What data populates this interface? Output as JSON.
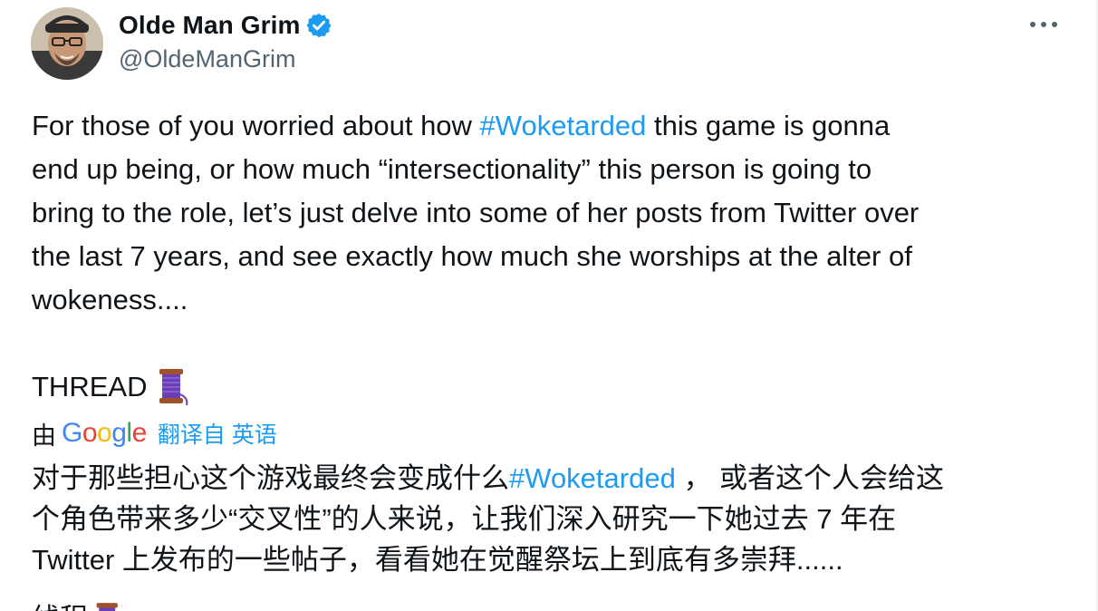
{
  "author": {
    "display_name": "Olde Man Grim",
    "handle": "@OldeManGrim",
    "verified_color": "#1d9bf0"
  },
  "menu": {
    "more_icon": "ellipsis-horizontal-icon"
  },
  "tweet": {
    "line1_pre": "For those of you worried about how ",
    "line1_hashtag": "#Woketarded",
    "line1_post": " this game is gonna",
    "line2": "end up being, or how much “intersectionality” this person is going to",
    "line3": "bring to the role, let’s just delve into some of her posts from Twitter over",
    "line4": "the last 7 years, and see exactly how much she worships at the alter of",
    "line5": "wokeness....",
    "thread_label": "THREAD",
    "thread_icon": "spool-of-thread-emoji"
  },
  "translation": {
    "by_label": "由",
    "google_logo": [
      "G",
      "o",
      "o",
      "g",
      "l",
      "e"
    ],
    "link_label": "翻译自 英语",
    "line1_pre": "对于那些担心这个游戏最终会变成什么",
    "line1_hashtag": "#Woketarded",
    "line1_post": " ， 或者这个人会给这",
    "line2": "个角色带来多少“交叉性”的人来说，让我们深入研究一下她过去 7 年在",
    "line3": "Twitter 上发布的一些帖子，看看她在觉醒祭坛上到底有多崇拜......",
    "thread_label": "线程"
  },
  "colors": {
    "text": "#0f1419",
    "secondary": "#536471",
    "accent": "#1d9bf0"
  }
}
